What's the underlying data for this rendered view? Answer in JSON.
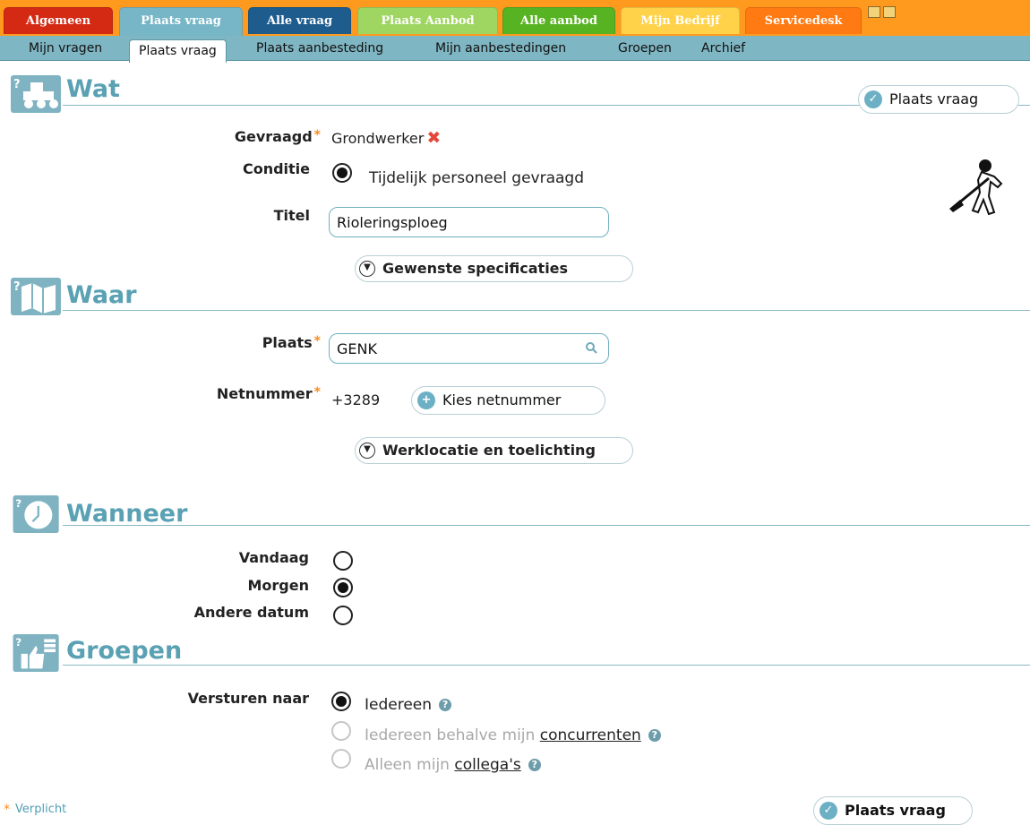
{
  "colors": {
    "accent": "#5aa1b3",
    "topbar": "#ff9a1f",
    "subnav": "#7fb6c3",
    "required": "#ff8a1e",
    "remove": "#e5463a"
  },
  "top_tabs": [
    {
      "label": "Algemeen",
      "color": "#d42a14"
    },
    {
      "label": "Plaats vraag",
      "color": "#77b6c7"
    },
    {
      "label": "Alle vraag",
      "color": "#1e5c8e"
    },
    {
      "label": "Plaats Aanbod",
      "color": "#9fd561"
    },
    {
      "label": "Alle aanbod",
      "color": "#58b322"
    },
    {
      "label": "Mijn Bedrijf",
      "color": "#ffd24a"
    },
    {
      "label": "Servicedesk",
      "color": "#ff7a12"
    }
  ],
  "sub_nav": [
    {
      "label": "Mijn vragen"
    },
    {
      "label": "Plaats vraag",
      "active": true
    },
    {
      "label": "Plaats aanbesteding"
    },
    {
      "label": "Mijn aanbestedingen"
    },
    {
      "label": "Groepen"
    },
    {
      "label": "Archief"
    }
  ],
  "sections": {
    "wat": {
      "title": "Wat",
      "icon": "truck-icon",
      "submit_label": "Plaats vraag",
      "gevraagd_label": "Gevraagd",
      "gevraagd_value": "Grondwerker",
      "remove_symbol": "✖",
      "conditie_label": "Conditie",
      "conditie_option": "Tijdelijk personeel gevraagd",
      "titel_label": "Titel",
      "titel_value": "Rioleringsploeg",
      "specs_expander": "Gewenste specificaties",
      "worker_icon": "worker-shovel-icon"
    },
    "waar": {
      "title": "Waar",
      "icon": "map-icon",
      "plaats_label": "Plaats",
      "plaats_value": "GENK",
      "netnummer_label": "Netnummer",
      "netnummer_value": "+3289",
      "kies_button": "Kies netnummer",
      "location_expander": "Werklocatie en toelichting"
    },
    "wanneer": {
      "title": "Wanneer",
      "icon": "clock-icon",
      "options": [
        {
          "label": "Vandaag",
          "checked": false
        },
        {
          "label": "Morgen",
          "checked": true
        },
        {
          "label": "Andere datum",
          "checked": false
        }
      ]
    },
    "groepen": {
      "title": "Groepen",
      "icon": "thumbs-icon",
      "versturen_label": "Versturen naar",
      "option1": "Iedereen",
      "option2_prefix": "Iedereen behalve mijn ",
      "option2_link": "concurrenten",
      "option3_prefix": "Alleen mijn ",
      "option3_link": "collega's"
    }
  },
  "footer": {
    "required_mark": "*",
    "required_text": "Verplicht",
    "submit_label": "Plaats vraag"
  }
}
